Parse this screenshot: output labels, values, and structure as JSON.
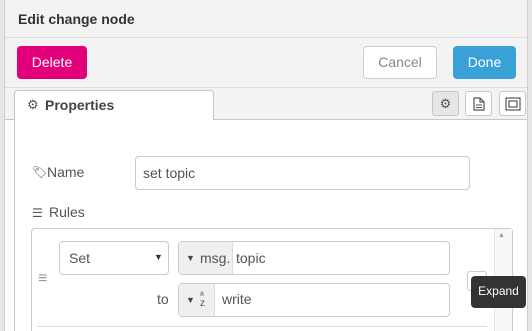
{
  "tray": {
    "title": "Edit change node"
  },
  "toolbar": {
    "delete_label": "Delete",
    "cancel_label": "Cancel",
    "done_label": "Done"
  },
  "tabs": [
    {
      "label": "Properties",
      "icon": "gear-icon",
      "selected": true
    }
  ],
  "tab_icons": [
    "gear-icon",
    "document-icon",
    "frame-icon"
  ],
  "form": {
    "name_label": "Name",
    "name_value": "set topic",
    "rules_label": "Rules"
  },
  "rule": {
    "action": "Set",
    "target_type": "msg.",
    "target_value": "topic",
    "to_label": "to",
    "value_type_icon": "string-az-icon",
    "value": "write"
  },
  "tooltip": {
    "text": "Expand"
  },
  "colors": {
    "delete": "#e2007a",
    "done": "#3aa1d8",
    "tooltip_bg": "#333333"
  }
}
